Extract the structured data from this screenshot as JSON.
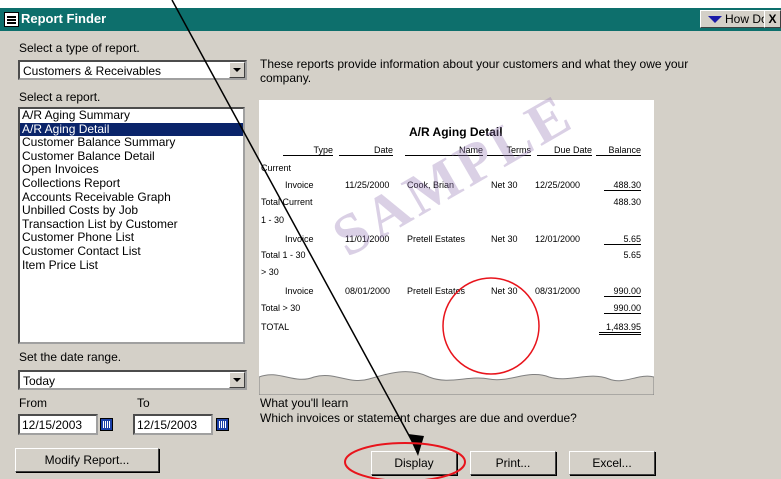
{
  "window": {
    "title": "Report Finder",
    "help_label": "How Do I?",
    "close_label": "X"
  },
  "type_section": {
    "label": "Select a type of report.",
    "selected": "Customers & Receivables"
  },
  "report_section": {
    "label": "Select a report.",
    "items": [
      "A/R Aging Summary",
      "A/R Aging Detail",
      "Customer Balance Summary",
      "Customer Balance Detail",
      "Open Invoices",
      "Collections Report",
      "Accounts Receivable Graph",
      "Unbilled Costs by Job",
      "Transaction List by Customer",
      "Customer Phone List",
      "Customer Contact List",
      "Item Price List"
    ],
    "selected_index": 1
  },
  "date_section": {
    "label": "Set the date range.",
    "range": "Today",
    "from_label": "From",
    "to_label": "To",
    "from_value": "12/15/2003",
    "to_value": "12/15/2003"
  },
  "description": "These reports provide information about your customers and what they owe your company.",
  "sample_report": {
    "title": "A/R Aging Detail",
    "watermark": "SAMPLE",
    "columns": [
      "Type",
      "Date",
      "Name",
      "Terms",
      "Due Date",
      "Balance"
    ],
    "rows": [
      {
        "label": "Current"
      },
      {
        "type": "Invoice",
        "date": "11/25/2000",
        "name": "Cook, Brian",
        "terms": "Net 30",
        "due": "12/25/2000",
        "balance": "488.30"
      },
      {
        "label": "Total Current",
        "total": "488.30"
      },
      {
        "label": "1 - 30"
      },
      {
        "type": "Invoice",
        "date": "11/01/2000",
        "name": "Pretell Estates",
        "terms": "Net 30",
        "due": "12/01/2000",
        "balance": "5.65"
      },
      {
        "label": "Total 1 - 30",
        "total": "5.65"
      },
      {
        "label": "> 30"
      },
      {
        "type": "Invoice",
        "date": "08/01/2000",
        "name": "Pretell Estates",
        "terms": "Net 30",
        "due": "08/31/2000",
        "balance": "990.00"
      },
      {
        "label": "Total > 30",
        "total": "990.00"
      },
      {
        "label": "TOTAL",
        "total": "1,483.95"
      }
    ]
  },
  "what_learn": {
    "heading": "What you'll learn",
    "text": "Which invoices or statement charges are due and overdue?"
  },
  "buttons": {
    "modify": "Modify Report...",
    "display": "Display",
    "print": "Print...",
    "excel": "Excel..."
  },
  "colors": {
    "titlebar": "#0d6f6c",
    "dialog": "#d4d0c8",
    "selection": "#0a246a",
    "annotation": "#e8141c"
  }
}
